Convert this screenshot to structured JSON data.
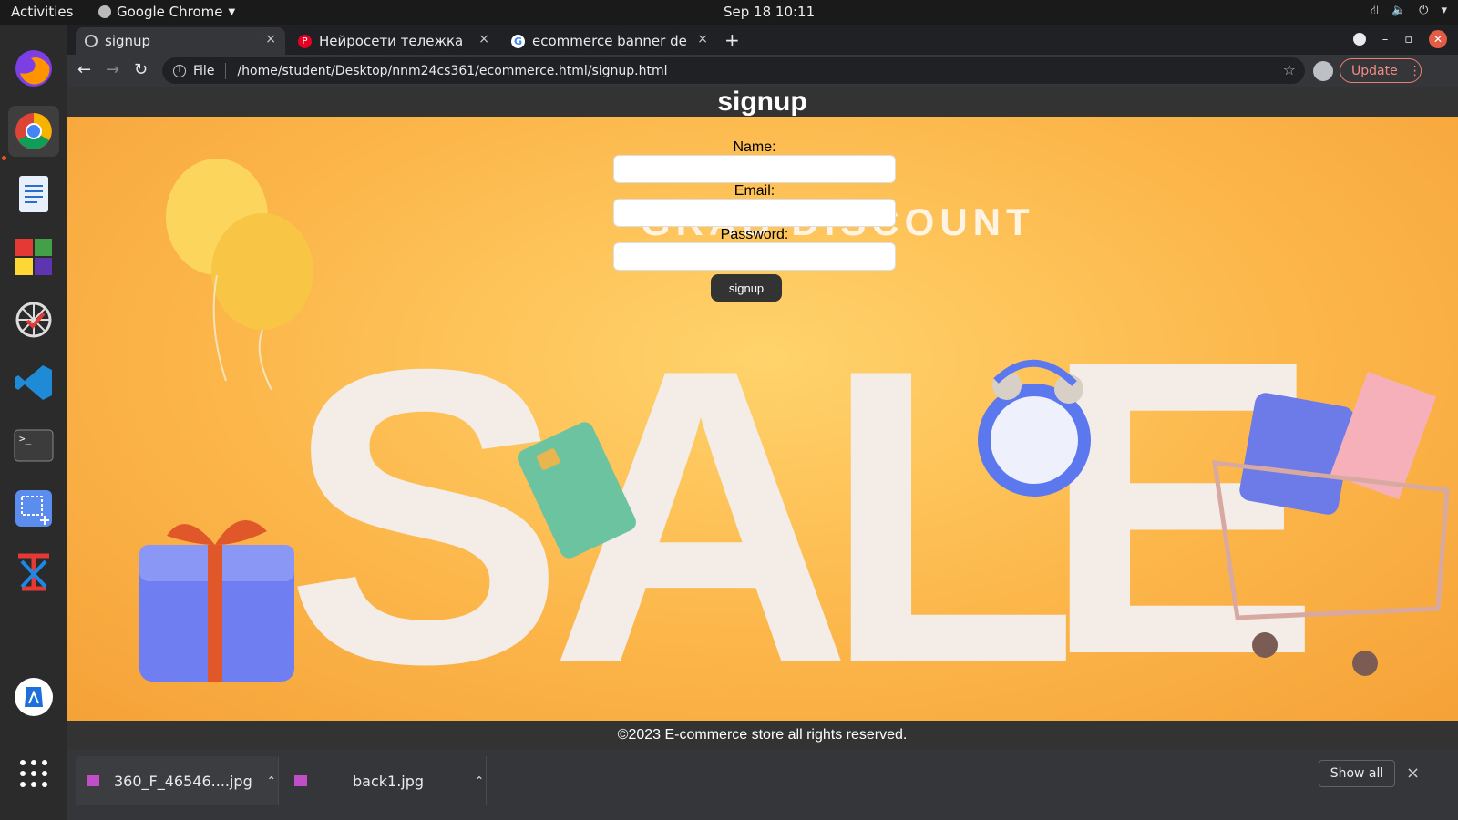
{
  "topbar": {
    "activities": "Activities",
    "app_name": "Google Chrome",
    "clock": "Sep 18  10:11"
  },
  "dock": {
    "items": [
      "firefox-icon",
      "chrome-icon",
      "writer-icon",
      "app-grid-color-icon",
      "network-icon",
      "vscode-icon",
      "terminal-icon",
      "screenshot-icon",
      "text-editor-icon",
      "software-icon",
      "show-apps-icon"
    ]
  },
  "tabs": [
    {
      "label": "signup",
      "close": "×"
    },
    {
      "label": "Нейросети тележка",
      "close": "×"
    },
    {
      "label": "ecommerce banner desig",
      "close": "×"
    }
  ],
  "newtab": "+",
  "address": {
    "scheme": "File",
    "url": "/home/student/Desktop/nnm24cs361/ecommerce.html/signup.html"
  },
  "update_label": "Update",
  "page": {
    "title": "signup",
    "banner_text": "GRAB DISCOUNT",
    "sale_letters": [
      "S",
      "A",
      "L",
      "E"
    ],
    "form": {
      "name_label": "Name:",
      "email_label": "Email:",
      "password_label": "Password:",
      "submit_label": "signup"
    },
    "footer": "©2023 E-commerce store all rights reserved."
  },
  "downloads": {
    "items": [
      {
        "name": "360_F_46546....jpg"
      },
      {
        "name": "back1.jpg"
      }
    ],
    "show_all": "Show all",
    "close": "×"
  },
  "colors": {
    "page_header_bg": "#333333",
    "hero_bg": "#fcb64a",
    "accent": "#e95420"
  }
}
